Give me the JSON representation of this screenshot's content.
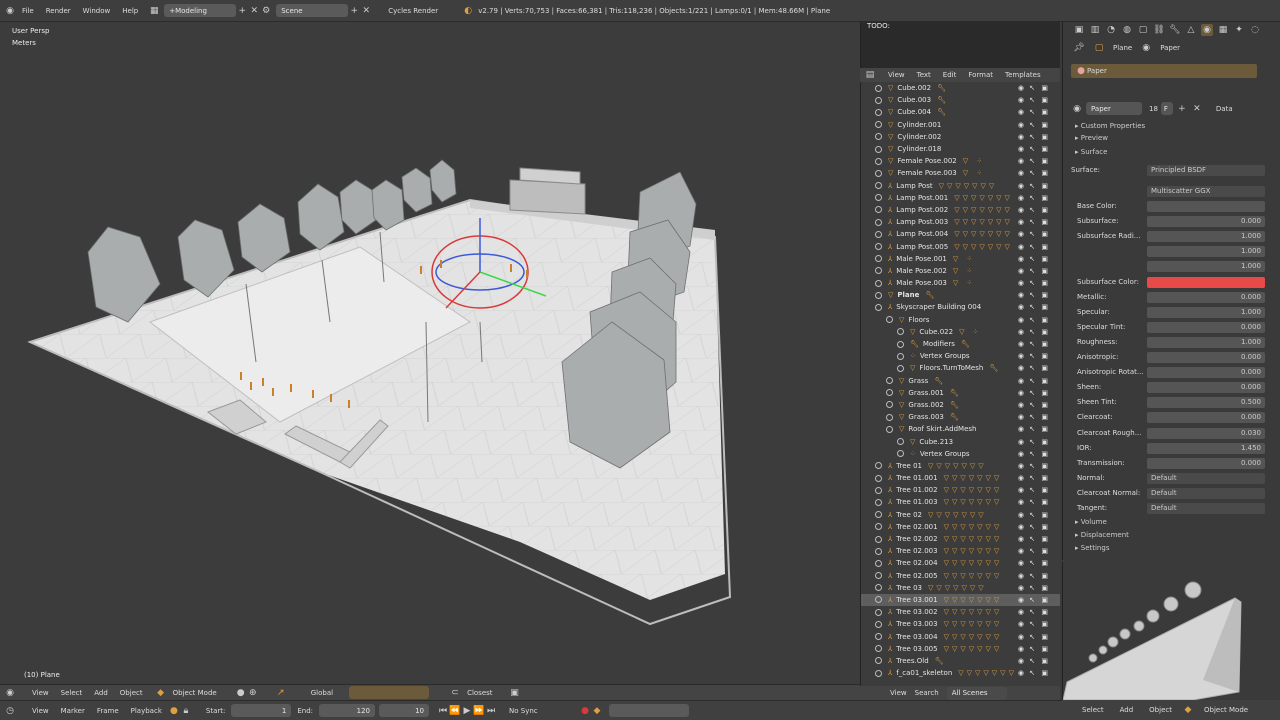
{
  "topbar": {
    "menus": [
      "File",
      "Render",
      "Window",
      "Help"
    ],
    "layout": "+Modeling",
    "scene": "Scene",
    "engine": "Cycles Render",
    "stats": "v2.79 | Verts:70,753 | Faces:66,381 | Tris:118,236 | Objects:1/221 | Lamps:0/1 | Mem:48.66M | Plane"
  },
  "viewport": {
    "perspective": "User Persp",
    "units": "Meters",
    "status": "(10) Plane"
  },
  "vp_header": {
    "menus": [
      "View",
      "Select",
      "Add",
      "Object"
    ],
    "mode": "Object Mode",
    "orientation": "Global",
    "snap": "Closest"
  },
  "timeline": {
    "menus": [
      "View",
      "Marker",
      "Frame",
      "Playback"
    ],
    "start_label": "Start:",
    "start": "1",
    "end_label": "End:",
    "end": "120",
    "current": "10",
    "sync": "No Sync"
  },
  "text_editor": {
    "text": "TODO:",
    "menus": [
      "View",
      "Text",
      "Edit",
      "Format",
      "Templates"
    ]
  },
  "outliner": {
    "rows": [
      {
        "name": "Cube.002",
        "indent": 0,
        "icon": "mesh",
        "mods": "wrench"
      },
      {
        "name": "Cube.003",
        "indent": 0,
        "icon": "mesh",
        "mods": "wrench"
      },
      {
        "name": "Cube.004",
        "indent": 0,
        "icon": "mesh",
        "mods": "wrench"
      },
      {
        "name": "Cylinder.001",
        "indent": 0,
        "icon": "mesh",
        "mods": ""
      },
      {
        "name": "Cylinder.002",
        "indent": 0,
        "icon": "mesh",
        "mods": ""
      },
      {
        "name": "Cylinder.018",
        "indent": 0,
        "icon": "mesh",
        "mods": ""
      },
      {
        "name": "Female Pose.002",
        "indent": 0,
        "icon": "mesh",
        "mods": "dots"
      },
      {
        "name": "Female Pose.003",
        "indent": 0,
        "icon": "mesh",
        "mods": "dots"
      },
      {
        "name": "Lamp Post",
        "indent": 0,
        "icon": "armature",
        "mods": "tris"
      },
      {
        "name": "Lamp Post.001",
        "indent": 0,
        "icon": "armature",
        "mods": "tris"
      },
      {
        "name": "Lamp Post.002",
        "indent": 0,
        "icon": "armature",
        "mods": "tris"
      },
      {
        "name": "Lamp Post.003",
        "indent": 0,
        "icon": "armature",
        "mods": "tris"
      },
      {
        "name": "Lamp Post.004",
        "indent": 0,
        "icon": "armature",
        "mods": "tris"
      },
      {
        "name": "Lamp Post.005",
        "indent": 0,
        "icon": "armature",
        "mods": "tris"
      },
      {
        "name": "Male Pose.001",
        "indent": 0,
        "icon": "armature",
        "mods": "dots"
      },
      {
        "name": "Male Pose.002",
        "indent": 0,
        "icon": "armature",
        "mods": "dots"
      },
      {
        "name": "Male Pose.003",
        "indent": 0,
        "icon": "armature",
        "mods": "dots"
      },
      {
        "name": "Plane",
        "indent": 0,
        "icon": "mesh",
        "mods": "wrench",
        "bold": true
      },
      {
        "name": "Skyscraper Building 004",
        "indent": 0,
        "icon": "armature",
        "mods": ""
      },
      {
        "name": "Floors",
        "indent": 1,
        "icon": "mesh",
        "mods": ""
      },
      {
        "name": "Cube.022",
        "indent": 2,
        "icon": "mesh",
        "mods": "dots"
      },
      {
        "name": "Modifiers",
        "indent": 2,
        "icon": "wrench",
        "mods": "wrench"
      },
      {
        "name": "Vertex Groups",
        "indent": 2,
        "icon": "dots",
        "mods": ""
      },
      {
        "name": "Floors.TurnToMesh",
        "indent": 2,
        "icon": "mesh",
        "mods": "wrench"
      },
      {
        "name": "Grass",
        "indent": 1,
        "icon": "mesh",
        "mods": "wrench"
      },
      {
        "name": "Grass.001",
        "indent": 1,
        "icon": "mesh",
        "mods": "wrench"
      },
      {
        "name": "Grass.002",
        "indent": 1,
        "icon": "mesh",
        "mods": "wrench"
      },
      {
        "name": "Grass.003",
        "indent": 1,
        "icon": "mesh",
        "mods": "wrench"
      },
      {
        "name": "Roof Skirt.AddMesh",
        "indent": 1,
        "icon": "mesh",
        "mods": ""
      },
      {
        "name": "Cube.213",
        "indent": 2,
        "icon": "mesh",
        "mods": ""
      },
      {
        "name": "Vertex Groups",
        "indent": 2,
        "icon": "dots",
        "mods": ""
      },
      {
        "name": "Tree 01",
        "indent": 0,
        "icon": "armature",
        "mods": "tris"
      },
      {
        "name": "Tree 01.001",
        "indent": 0,
        "icon": "armature",
        "mods": "tris"
      },
      {
        "name": "Tree 01.002",
        "indent": 0,
        "icon": "armature",
        "mods": "tris"
      },
      {
        "name": "Tree 01.003",
        "indent": 0,
        "icon": "armature",
        "mods": "tris"
      },
      {
        "name": "Tree 02",
        "indent": 0,
        "icon": "armature",
        "mods": "tris"
      },
      {
        "name": "Tree 02.001",
        "indent": 0,
        "icon": "armature",
        "mods": "tris"
      },
      {
        "name": "Tree 02.002",
        "indent": 0,
        "icon": "armature",
        "mods": "tris"
      },
      {
        "name": "Tree 02.003",
        "indent": 0,
        "icon": "armature",
        "mods": "tris"
      },
      {
        "name": "Tree 02.004",
        "indent": 0,
        "icon": "armature",
        "mods": "tris"
      },
      {
        "name": "Tree 02.005",
        "indent": 0,
        "icon": "armature",
        "mods": "tris"
      },
      {
        "name": "Tree 03",
        "indent": 0,
        "icon": "armature",
        "mods": "tris"
      },
      {
        "name": "Tree 03.001",
        "indent": 0,
        "icon": "armature",
        "mods": "tris",
        "selected": true
      },
      {
        "name": "Tree 03.002",
        "indent": 0,
        "icon": "armature",
        "mods": "tris"
      },
      {
        "name": "Tree 03.003",
        "indent": 0,
        "icon": "armature",
        "mods": "tris"
      },
      {
        "name": "Tree 03.004",
        "indent": 0,
        "icon": "armature",
        "mods": "tris"
      },
      {
        "name": "Tree 03.005",
        "indent": 0,
        "icon": "armature",
        "mods": "tris"
      },
      {
        "name": "Trees.Old",
        "indent": 0,
        "icon": "armature",
        "mods": "wrench"
      },
      {
        "name": "f_ca01_skeleton",
        "indent": 0,
        "icon": "armature",
        "mods": "tris"
      }
    ],
    "footer": [
      "View",
      "Search",
      "All Scenes"
    ]
  },
  "properties": {
    "breadcrumb_obj": "Plane",
    "breadcrumb_mat": "Paper",
    "material_slot": "Paper",
    "material_name": "Paper",
    "users": "18",
    "link": "F",
    "link_to": "Data",
    "panels": [
      "Custom Properties",
      "Preview",
      "Surface"
    ],
    "surface_label": "Surface:",
    "shader": "Principled BSDF",
    "distribution": "Multiscatter GGX",
    "fields": [
      {
        "label": "Base Color:",
        "value": ""
      },
      {
        "label": "Subsurface:",
        "value": "0.000"
      },
      {
        "label": "Subsurface Radi...",
        "value": "1.000"
      },
      {
        "label": "",
        "value": "1.000"
      },
      {
        "label": "",
        "value": "1.000"
      },
      {
        "label": "Subsurface Color:",
        "value": "",
        "color": "#e84a4a"
      },
      {
        "label": "Metallic:",
        "value": "0.000"
      },
      {
        "label": "Specular:",
        "value": "1.000"
      },
      {
        "label": "Specular Tint:",
        "value": "0.000"
      },
      {
        "label": "Roughness:",
        "value": "1.000"
      },
      {
        "label": "Anisotropic:",
        "value": "0.000"
      },
      {
        "label": "Anisotropic Rotat...",
        "value": "0.000"
      },
      {
        "label": "Sheen:",
        "value": "0.000"
      },
      {
        "label": "Sheen Tint:",
        "value": "0.500"
      },
      {
        "label": "Clearcoat:",
        "value": "0.000"
      },
      {
        "label": "Clearcoat Rough...",
        "value": "0.030"
      },
      {
        "label": "IOR:",
        "value": "1.450"
      },
      {
        "label": "Transmission:",
        "value": "0.000"
      },
      {
        "label": "Normal:",
        "value": "Default"
      },
      {
        "label": "Clearcoat Normal:",
        "value": "Default"
      },
      {
        "label": "Tangent:",
        "value": "Default"
      }
    ],
    "bottom_panels": [
      "Volume",
      "Displacement",
      "Settings"
    ],
    "accent": "#e0a040",
    "material_bar": "#6b5b3a"
  },
  "footer": {
    "menus": [
      "Select",
      "Add",
      "Object"
    ],
    "mode": "Object Mode"
  }
}
